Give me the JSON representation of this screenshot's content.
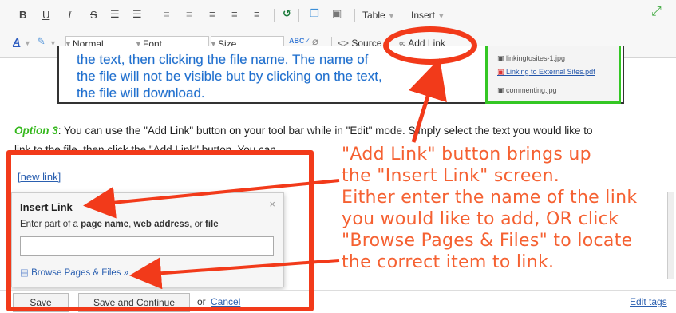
{
  "toolbar": {
    "row1": {
      "bold": "B",
      "underline": "U",
      "italic": "I",
      "strike": "S",
      "table": "Table",
      "insert": "Insert"
    },
    "row2": {
      "style_value": "Normal",
      "font_value": "Font",
      "size_value": "Size",
      "source": "Source",
      "add_link": "Add Link"
    }
  },
  "embedded": {
    "lines": [
      "the text, then clicking the file name. The name of",
      "the file will not be visible but by clicking on the text,",
      "the file will download."
    ],
    "files": [
      "linkingtosites-1.jpg",
      "Linking to External Sites.pdf",
      "commenting.jpg"
    ]
  },
  "paragraph": {
    "option": "Option 3",
    "text1": ": You can use the \"Add Link\" button on your tool bar while in \"Edit\" mode.  Simply select the text you would like to",
    "text2": "link to the file, then click the \"Add Link\" button.  You can"
  },
  "new_link": "[new link]",
  "insert_link": {
    "title": "Insert Link",
    "close": "×",
    "hint_pre": "Enter part of a ",
    "hint_b1": "page name",
    "hint_mid1": ", ",
    "hint_b2": "web address",
    "hint_mid2": ", or ",
    "hint_b3": "file",
    "browse": "Browse Pages & Files »"
  },
  "annotation": [
    "\"Add Link\" button brings up",
    "the \"Insert Link\" screen.",
    "Either enter the name of the link",
    "you would like to add, OR click",
    "\"Browse Pages & Files\" to locate",
    "the correct item to link."
  ],
  "bottom": {
    "save": "Save",
    "save_continue": "Save and Continue",
    "or": "or",
    "cancel": "Cancel",
    "edit_tags": "Edit tags"
  },
  "colors": {
    "annotation_red": "#f23a1a",
    "annotation_text": "#f56132",
    "option_green": "#36b81e",
    "highlight_green": "#34c724",
    "embedded_blue": "#1e6fd0"
  }
}
